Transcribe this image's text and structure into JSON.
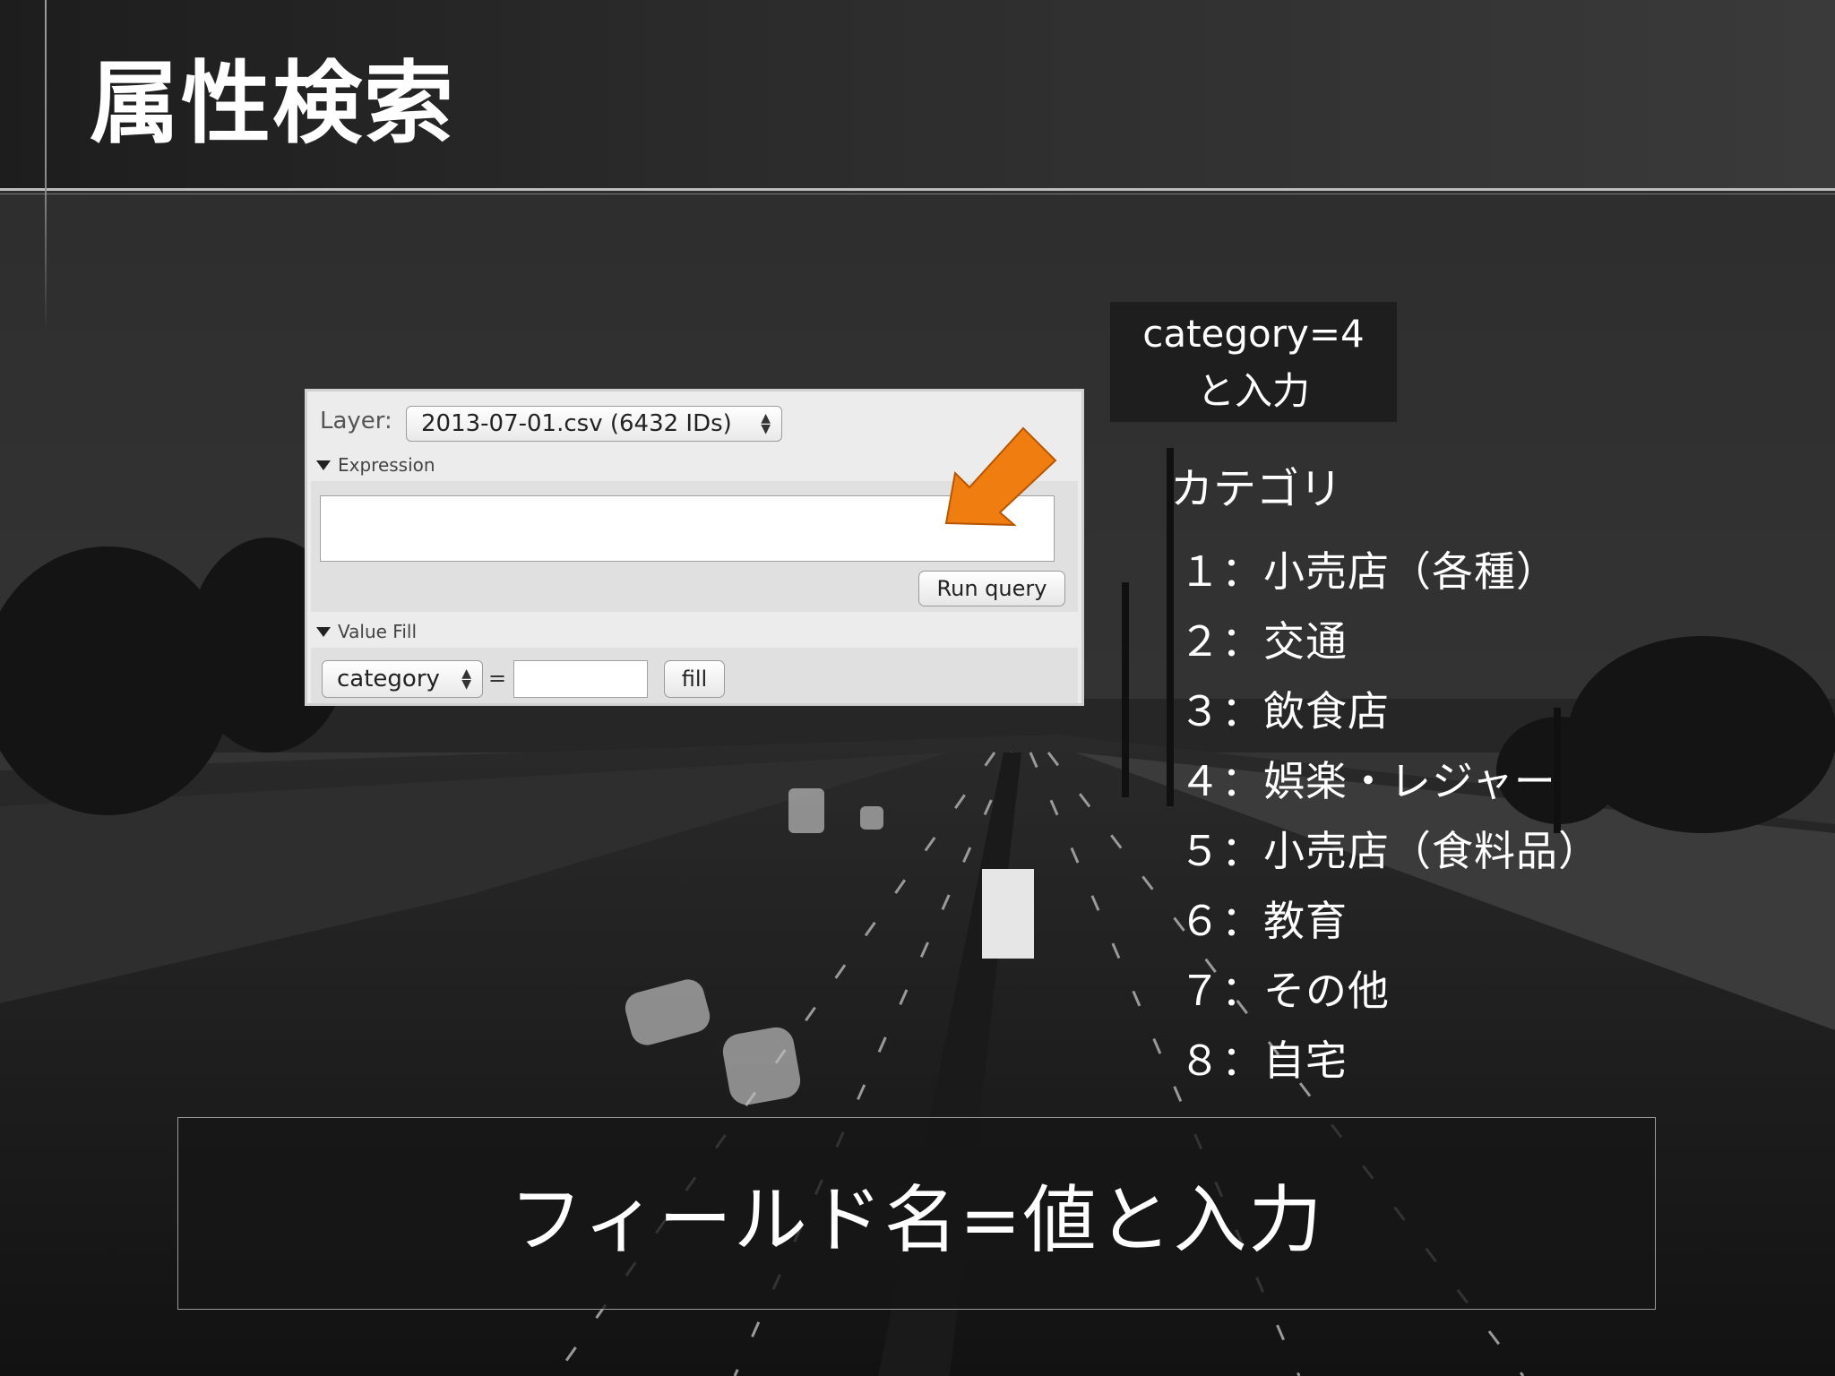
{
  "slide": {
    "title": "属性検索"
  },
  "panel": {
    "layer_label": "Layer:",
    "layer_value": "2013-07-01.csv (6432 IDs)",
    "expression_label": "Expression",
    "run_query_label": "Run query",
    "value_fill_label": "Value Fill",
    "field_value": "category",
    "equals": "=",
    "fill_label": "fill"
  },
  "callout": {
    "line1": "category=4",
    "line2": "と入力"
  },
  "categories": {
    "title": "カテゴリ",
    "items": [
      "１：小売店（各種）",
      "２：交通",
      "３：飲食店",
      "４：娯楽・レジャー",
      "５：小売店（食料品）",
      "６：教育",
      "７：その他",
      "８：自宅"
    ]
  },
  "caption": {
    "text": "フィールド名=値と入力"
  },
  "colors": {
    "arrow": "#f07d10",
    "background": "#1c1c1c"
  },
  "icons": {
    "arrow": "arrow-pointer-icon",
    "disclosure": "triangle-down-icon",
    "stepper": "up-down-arrows-icon"
  }
}
